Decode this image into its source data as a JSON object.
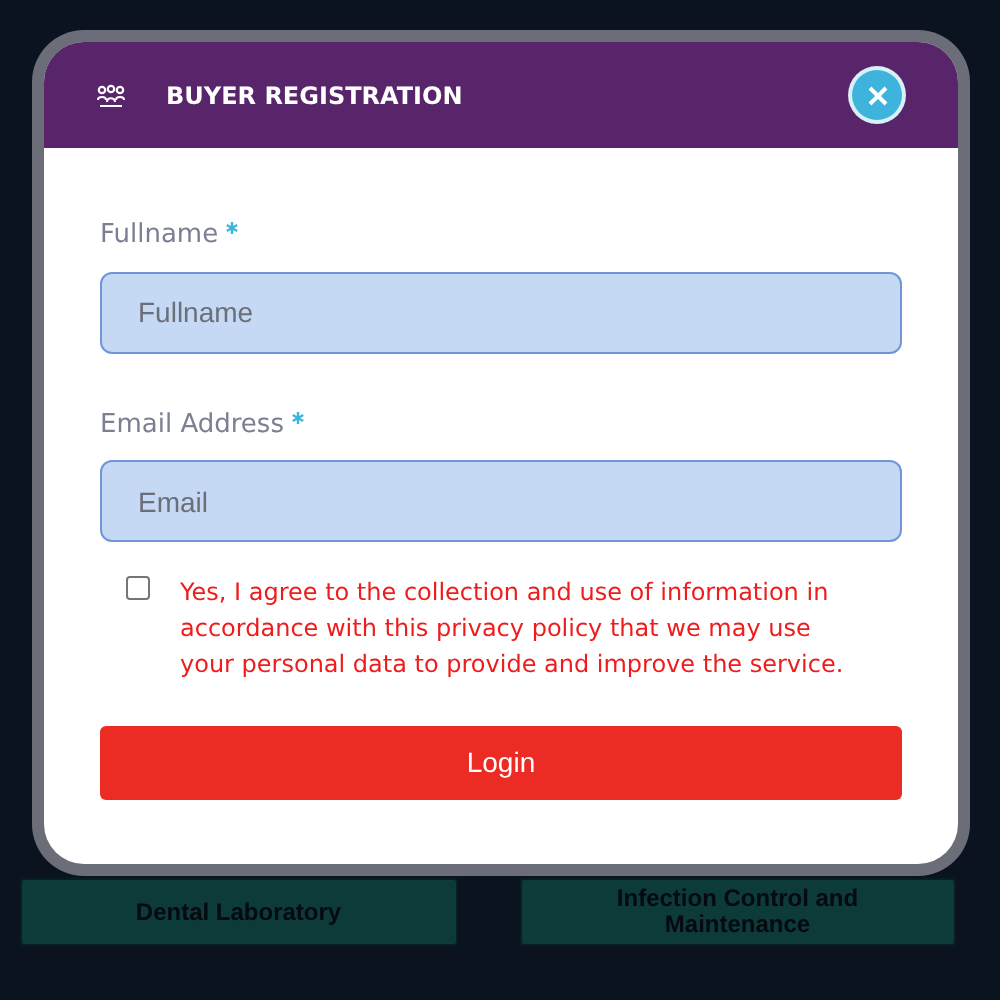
{
  "background": {
    "cards": [
      {
        "label": "Dental Laboratory"
      },
      {
        "label": "Infection Control and Maintenance"
      }
    ]
  },
  "modal": {
    "title": "BUYER REGISTRATION",
    "fields": [
      {
        "label": "Fullname",
        "required": true,
        "placeholder": "Fullname"
      },
      {
        "label": "Email Address",
        "required": true,
        "placeholder": "Email"
      }
    ],
    "consent": {
      "checked": false,
      "text": "Yes, I agree to the collection and use of information in accordance with this privacy policy that we may use your personal data to provide and improve the service."
    },
    "submit": "Login"
  }
}
